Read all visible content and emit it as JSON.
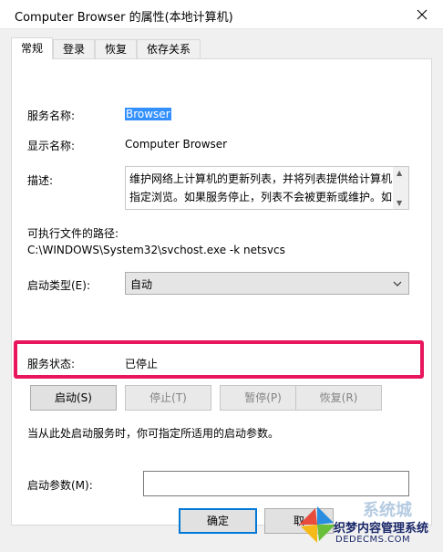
{
  "window": {
    "title": "Computer Browser 的属性(本地计算机)"
  },
  "tabs": [
    "常规",
    "登录",
    "恢复",
    "依存关系"
  ],
  "general": {
    "service_name_label": "服务名称:",
    "service_name_value": "Browser",
    "display_name_label": "显示名称:",
    "display_name_value": "Computer Browser",
    "description_label": "描述:",
    "description_value": "维护网络上计算机的更新列表，并将列表提供给计算机指定浏览。如果服务停止，列表不会被更新或维护。如",
    "path_label": "可执行文件的路径:",
    "path_value": "C:\\WINDOWS\\System32\\svchost.exe -k netsvcs",
    "startup_type_label": "启动类型(E):",
    "startup_type_value": "自动",
    "status_label": "服务状态:",
    "status_value": "已停止",
    "buttons": {
      "start": "启动(S)",
      "stop": "停止(T)",
      "pause": "暂停(P)",
      "resume": "恢复(R)"
    },
    "hint": "当从此处启动服务时，你可指定所适用的启动参数。",
    "param_label": "启动参数(M):",
    "param_value": ""
  },
  "footer": {
    "ok": "确定",
    "cancel": "取"
  },
  "watermark": {
    "top": "系统城",
    "line1": "织梦内容管理系统",
    "line2": "DEDECMS.COM"
  },
  "colors": {
    "highlight": "#e8175d",
    "accent": "#0078d7"
  }
}
